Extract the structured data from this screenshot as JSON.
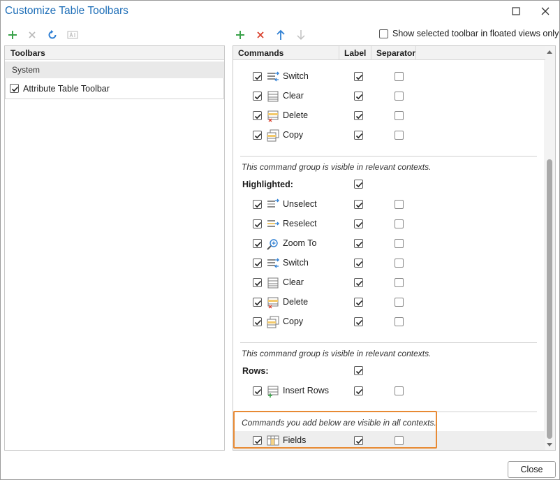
{
  "window": {
    "title": "Customize Table Toolbars"
  },
  "left_toolbar": {
    "icons": [
      "add-icon",
      "delete-icon",
      "reset-icon",
      "rename-icon"
    ]
  },
  "right_toolbar": {
    "icons": [
      "add-icon",
      "delete-icon",
      "move-up-icon",
      "move-down-icon"
    ],
    "show_selected_label": "Show selected toolbar in floated views only",
    "show_selected_checked": false
  },
  "left_pane": {
    "header": "Toolbars",
    "group": "System",
    "items": [
      {
        "label": "Attribute Table Toolbar",
        "checked": true
      }
    ]
  },
  "right_pane": {
    "columns": {
      "commands": "Commands",
      "label": "Label",
      "separator": "Separator"
    },
    "partial_row_label": "Zoom To",
    "groups": [
      {
        "commands": [
          {
            "label": "Switch",
            "icon": "switch-icon",
            "checked": true,
            "show_label": true,
            "separator": false
          },
          {
            "label": "Clear",
            "icon": "clear-icon",
            "checked": true,
            "show_label": true,
            "separator": false
          },
          {
            "label": "Delete",
            "icon": "delete-rows-icon",
            "checked": true,
            "show_label": true,
            "separator": false
          },
          {
            "label": "Copy",
            "icon": "copy-icon",
            "checked": true,
            "show_label": true,
            "separator": false
          }
        ]
      },
      {
        "note": "This command group is visible in relevant contexts.",
        "title": "Highlighted:",
        "title_label_checked": true,
        "commands": [
          {
            "label": "Unselect",
            "icon": "unselect-icon",
            "checked": true,
            "show_label": true,
            "separator": false
          },
          {
            "label": "Reselect",
            "icon": "reselect-icon",
            "checked": true,
            "show_label": true,
            "separator": false
          },
          {
            "label": "Zoom To",
            "icon": "zoom-to-icon",
            "checked": true,
            "show_label": true,
            "separator": false
          },
          {
            "label": "Switch",
            "icon": "switch-icon",
            "checked": true,
            "show_label": true,
            "separator": false
          },
          {
            "label": "Clear",
            "icon": "clear-icon",
            "checked": true,
            "show_label": true,
            "separator": false
          },
          {
            "label": "Delete",
            "icon": "delete-rows-icon",
            "checked": true,
            "show_label": true,
            "separator": false
          },
          {
            "label": "Copy",
            "icon": "copy-icon",
            "checked": true,
            "show_label": true,
            "separator": false
          }
        ]
      },
      {
        "note": "This command group is visible in relevant contexts.",
        "title": "Rows:",
        "title_label_checked": true,
        "commands": [
          {
            "label": "Insert Rows",
            "icon": "insert-rows-icon",
            "checked": true,
            "show_label": true,
            "separator": false
          }
        ]
      },
      {
        "note": "Commands you add below are visible in all contexts.",
        "commands": [
          {
            "label": "Fields",
            "icon": "fields-icon",
            "checked": true,
            "show_label": true,
            "separator": false
          }
        ]
      }
    ]
  },
  "footer": {
    "close_label": "Close"
  },
  "colors": {
    "accent": "#1f6fb8",
    "add_green": "#3aa24a",
    "delete_red": "#d9412e",
    "highlight_border": "#e88a34"
  }
}
